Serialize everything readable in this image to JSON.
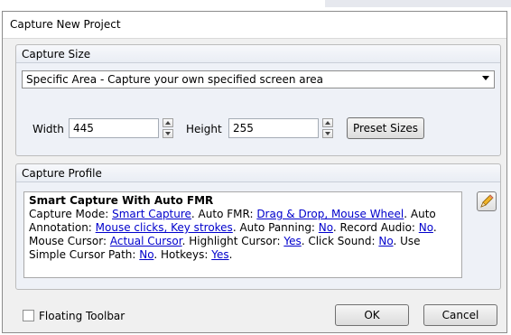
{
  "window": {
    "title": "Capture New Project"
  },
  "capture_size": {
    "group_title": "Capture Size",
    "mode_select": "Specific Area - Capture your own specified screen area",
    "width_label": "Width",
    "width_value": "445",
    "height_label": "Height",
    "height_value": "255",
    "preset_button": "Preset Sizes"
  },
  "capture_profile": {
    "group_title": "Capture Profile",
    "profile_name": "Smart Capture With Auto FMR",
    "t1": "Capture Mode: ",
    "l1": "Smart Capture",
    "t2": ". Auto FMR: ",
    "l2": "Drag & Drop, Mouse Wheel",
    "t3": ". Auto Annotation: ",
    "l3": "Mouse clicks, Key strokes",
    "t4": ". Auto Panning: ",
    "l4": "No",
    "t5": ". Record Audio: ",
    "l5": "No",
    "t6": ". Mouse Cursor: ",
    "l6": "Actual Cursor",
    "t7": ". Highlight Cursor: ",
    "l7": "Yes",
    "t8": ". Click Sound: ",
    "l8": "No",
    "t9": ". Use Simple Cursor Path: ",
    "l9": "No",
    "t10": ". Hotkeys: ",
    "l10": "Yes",
    "t11": "."
  },
  "footer": {
    "floating_toolbar_label": "Floating Toolbar",
    "floating_toolbar_checked": false,
    "ok_button": "OK",
    "cancel_button": "Cancel"
  },
  "icons": {
    "edit_profile": "pencil-icon"
  }
}
